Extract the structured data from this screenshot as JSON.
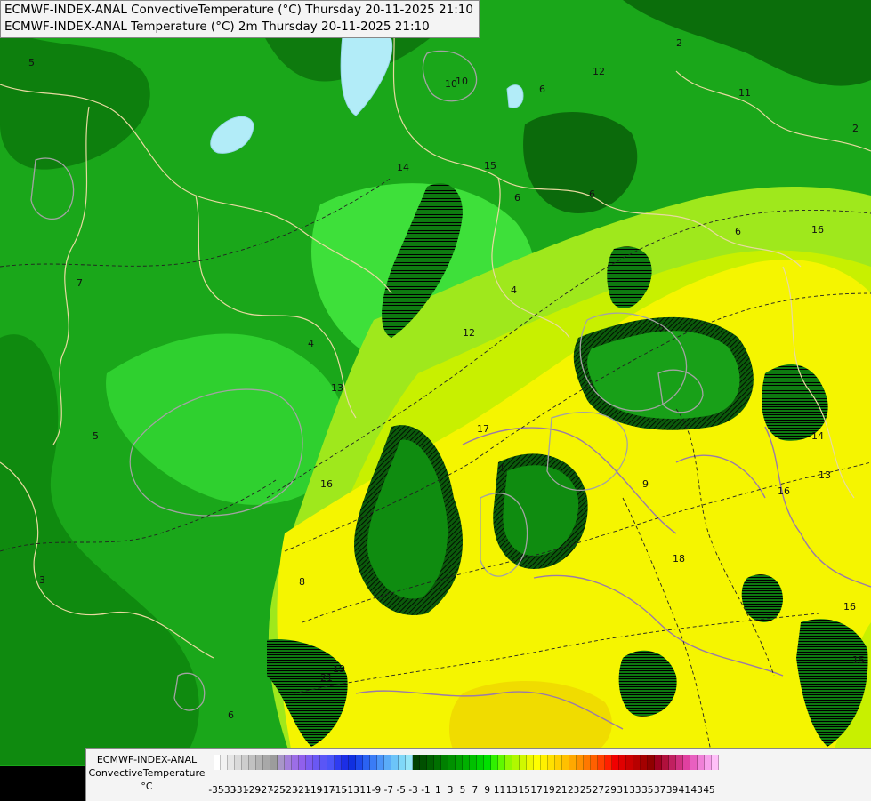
{
  "titles": [
    "ECMWF-INDEX-ANAL ConvectiveTemperature (°C) Thursday 20-11-2025 21:10",
    "ECMWF-INDEX-ANAL Temperature (°C) 2m Thursday 20-11-2025 21:10"
  ],
  "legend": {
    "model": "ECMWF-INDEX-ANAL",
    "variable": "ConvectiveTemperature",
    "unit": "°C",
    "ticks": [
      "-35",
      "-33",
      "-31",
      "-29",
      "-27",
      "-25",
      "-23",
      "-21",
      "-19",
      "-17",
      "-15",
      "-13",
      "-11",
      "-9",
      "-7",
      "-5",
      "-3",
      "-1",
      "1",
      "3",
      "5",
      "7",
      "9",
      "11",
      "13",
      "15",
      "17",
      "19",
      "21",
      "23",
      "25",
      "27",
      "29",
      "31",
      "33",
      "35",
      "37",
      "39",
      "41",
      "43",
      "45"
    ],
    "colors": [
      "#ffffff",
      "#f2f2f2",
      "#e6e6e6",
      "#dadada",
      "#cdcdcd",
      "#c1c1c1",
      "#b4b4b4",
      "#a8a8a8",
      "#9c9c9c",
      "#a896c8",
      "#a480dc",
      "#9c6ee6",
      "#9060ec",
      "#7c5cf2",
      "#6a58f4",
      "#5a56f6",
      "#4a54f8",
      "#2e3cf2",
      "#1c2ee6",
      "#1030e0",
      "#1c48ec",
      "#2a62f2",
      "#3a7cf6",
      "#4a94f8",
      "#5aacf8",
      "#6cc4f8",
      "#80d8f8",
      "#96e6f8",
      "#004000",
      "#005000",
      "#006000",
      "#007000",
      "#008000",
      "#009000",
      "#00a000",
      "#00b000",
      "#00c000",
      "#00d000",
      "#00e000",
      "#30f000",
      "#60f800",
      "#90f800",
      "#b0f800",
      "#d0f800",
      "#eef800",
      "#ffff00",
      "#fff000",
      "#ffe000",
      "#ffd000",
      "#ffc000",
      "#ffa800",
      "#ff9000",
      "#ff7800",
      "#ff6000",
      "#ff4000",
      "#ff2000",
      "#f00000",
      "#e00000",
      "#cc0000",
      "#b80000",
      "#a40000",
      "#900000",
      "#a00020",
      "#b0103c",
      "#c02060",
      "#d03080",
      "#e040a0",
      "#e860c0",
      "#f080d8",
      "#f8a0ec",
      "#ffc0f8"
    ]
  },
  "map_labels": [
    "10",
    "10",
    "6",
    "6",
    "6",
    "6",
    "12",
    "11",
    "2",
    "2",
    "5",
    "7",
    "9",
    "4",
    "12",
    "17",
    "18",
    "16",
    "14",
    "15",
    "13",
    "15",
    "16",
    "19",
    "21",
    "14",
    "3",
    "4",
    "5",
    "5",
    "6",
    "8",
    "13",
    "16",
    "16",
    "4"
  ]
}
